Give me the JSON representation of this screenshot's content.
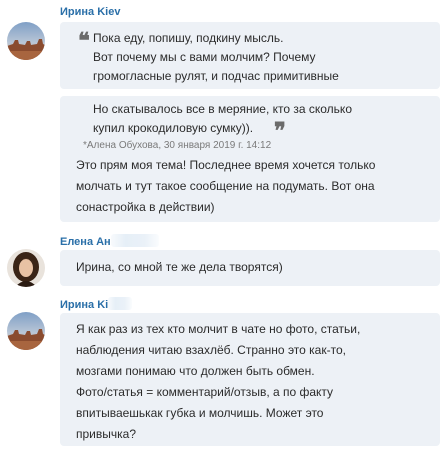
{
  "messages": [
    {
      "author": "Ирина Kiev",
      "quote1": {
        "lines": [
          "Пока еду, попишу, подкину мысль.",
          "Вот почему мы с вами молчим? Почему",
          "громогласные рулят, и подчас примитивные"
        ]
      },
      "quote2": {
        "lines": [
          "Но скатывалось все в меряние, кто за сколько",
          "купил крокодиловую сумку))."
        ],
        "attribution": "*Алена Обухова, 30 января 2019 г. 14:12"
      },
      "text_lines": [
        "Это прям моя тема! Последнее время хочется только",
        "молчать и тут такое сообщение на подумать. Вот она",
        "сонастройка в действии)"
      ]
    },
    {
      "author": "Елена Ан",
      "text_lines": [
        "Ирина, со мной те же дела творятся)"
      ]
    },
    {
      "author": "Ирина Ki",
      "text_lines": [
        "Я как раз из тех кто молчит в чате но фото, статьи,",
        "наблюдения читаю взахлёб. Странно это как-то,",
        "мозгами понимаю что должен быть обмен.",
        "Фото/статья = комментарий/отзыв, а по факту",
        "впитываешькак губка и молчишь. Может это",
        "привычка?"
      ]
    }
  ],
  "icons": {
    "open_quote": "open-quote-icon",
    "close_quote": "close-quote-icon"
  },
  "colors": {
    "author_name": "#2a6fa8",
    "bubble_bg": "#edf1f6",
    "text": "#2b2b2b",
    "meta": "#7a7a7a"
  }
}
